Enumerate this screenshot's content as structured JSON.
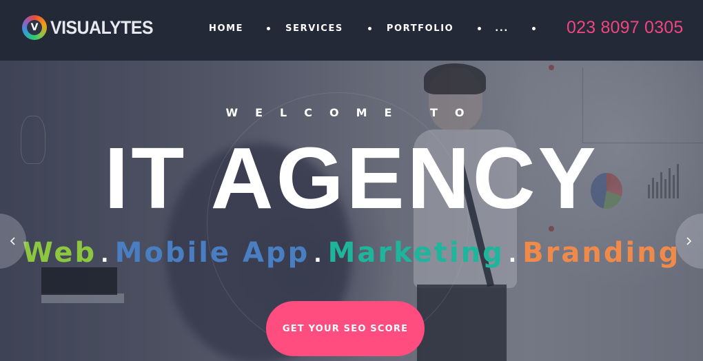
{
  "header": {
    "logo_text": "VISUALYTES",
    "logo_mark_letter": "V",
    "nav": [
      {
        "label": "HOME"
      },
      {
        "label": "SERVICES"
      },
      {
        "label": "PORTFOLIO"
      },
      {
        "label": "..."
      }
    ],
    "phone": "023 8097 0305"
  },
  "hero": {
    "welcome": "WELCOME TO",
    "title": "IT AGENCY",
    "tagline": {
      "web": "Web",
      "mobile": "Mobile App",
      "marketing": "Marketing",
      "branding": "Branding",
      "separator": "."
    },
    "cta_label": "GET YOUR SEO SCORE"
  },
  "icons": {
    "prev": "chevron-left-icon",
    "next": "chevron-right-icon"
  },
  "colors": {
    "header_bg": "#232937",
    "phone": "#f0467f",
    "cta": "#ff4d80",
    "web": "#8dc63f",
    "mobile": "#4a7ec2",
    "marketing": "#1fb59d",
    "branding": "#f08a4b"
  }
}
